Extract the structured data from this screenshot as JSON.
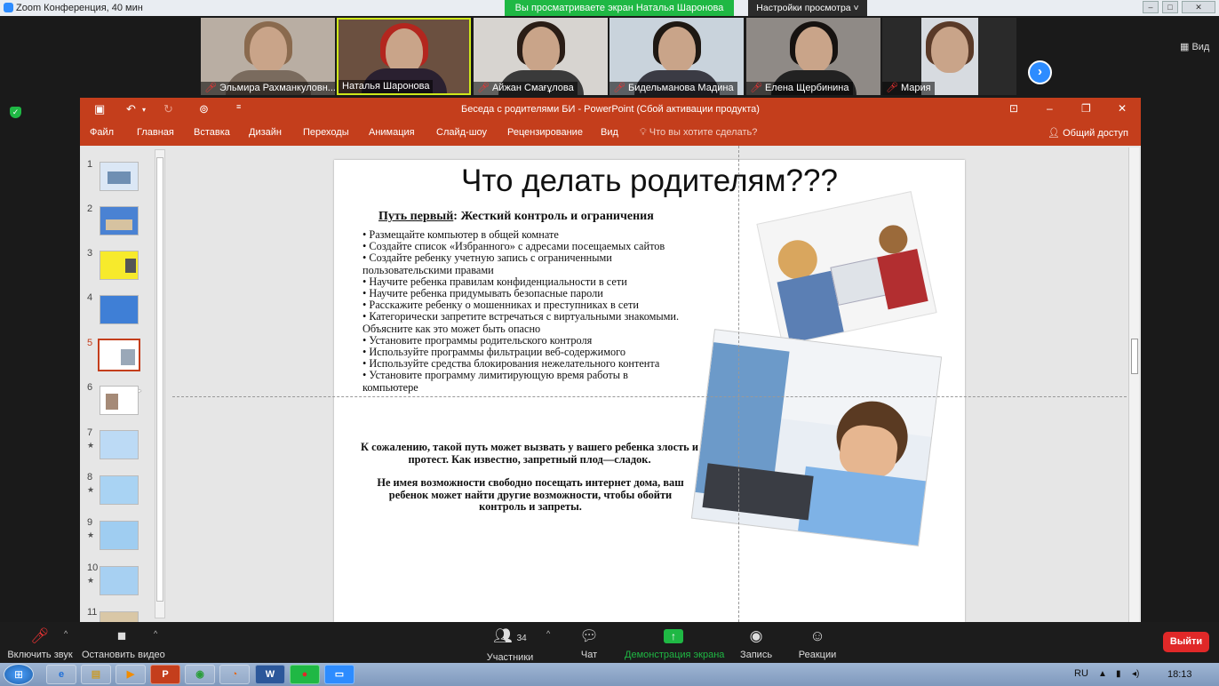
{
  "zoom": {
    "window_title": "Zoom Конференция, 40 мин",
    "share_banner": "Вы просматриваете экран Наталья Шаронова",
    "view_options": "Настройки просмотра ˅",
    "view_button": "▦ Вид",
    "win_minimize": "–",
    "win_maximize": "□",
    "win_close": "✕",
    "next_page_glyph": "›",
    "participants": [
      {
        "name": "Эльмира Рахманкуловн...",
        "muted": true
      },
      {
        "name": "Наталья Шаронова",
        "muted": false
      },
      {
        "name": "Айжан Смағұлова",
        "muted": true
      },
      {
        "name": "Бидельманова Мадина",
        "muted": true
      },
      {
        "name": "Елена Щербинина",
        "muted": true
      },
      {
        "name": "Мария",
        "muted": true
      }
    ],
    "controls": {
      "unmute": "Включить звук",
      "stop_video": "Остановить видео",
      "participants_label": "Участники",
      "participants_count": "34",
      "chat": "Чат",
      "share_screen": "Демонстрация экрана",
      "record": "Запись",
      "reactions": "Реакции",
      "leave": "Выйти"
    },
    "colors": {
      "accent": "#2d8cff",
      "green": "#1fb844",
      "leave": "#e02828"
    }
  },
  "powerpoint": {
    "title": "Беседа с родителями БИ - PowerPoint (Сбой активации продукта)",
    "tabs": [
      "Файл",
      "Главная",
      "Вставка",
      "Дизайн",
      "Переходы",
      "Анимация",
      "Слайд-шоу",
      "Рецензирование",
      "Вид"
    ],
    "tell_me": "Что вы хотите сделать?",
    "share": "Общий доступ",
    "accent_color": "#c43e1c",
    "thumbnails": [
      {
        "num": "1",
        "star": ""
      },
      {
        "num": "2",
        "star": ""
      },
      {
        "num": "3",
        "star": ""
      },
      {
        "num": "4",
        "star": ""
      },
      {
        "num": "5",
        "star": ""
      },
      {
        "num": "6",
        "star": ""
      },
      {
        "num": "7",
        "star": "★"
      },
      {
        "num": "8",
        "star": "★"
      },
      {
        "num": "9",
        "star": "★"
      },
      {
        "num": "10",
        "star": "★"
      },
      {
        "num": "11",
        "star": ""
      }
    ],
    "selected_slide": 5
  },
  "slide": {
    "title": "Что делать родителям???",
    "path_label": "Путь первый",
    "path_rest": ":  Жесткий контроль и ограничения",
    "bullets": [
      "• Размещайте компьютер в общей комнате",
      "• Создайте список «Избранного» с адресами посещаемых сайтов",
      "• Создайте ребенку учетную запись с ограниченными пользовательскими правами",
      "• Научите ребенка правилам конфиденциальности в сети",
      "• Научите ребенка придумывать безопасные пароли",
      "• Расскажите ребенку о мошенниках и преступниках в сети",
      "• Категорически запретите встречаться с виртуальными знакомыми. Объясните как это может быть опасно",
      "• Установите программы родительского контроля",
      "• Используйте программы фильтрации веб-содержимого",
      "• Используйте средства блокирования нежелательного контента",
      "• Установите программу лимитирующую время работы в компьютере"
    ],
    "warning_1": "К сожалению, такой путь может вызвать у вашего ребенка злость и протест. Как известно, запретный плод—сладок.",
    "warning_2": "Не имея возможности свободно посещать интернет дома, ваш ребенок может найти другие возможности, чтобы обойти контроль и запреты."
  },
  "taskbar": {
    "apps": [
      "e",
      "▤",
      "▶",
      "P",
      "◉",
      "◔",
      "W",
      "●",
      "▭"
    ],
    "lang": "RU",
    "time": "18:13",
    "start_glyph": "⊞",
    "tray_up": "▲",
    "tray_net": "▮",
    "tray_vol": "◂)"
  }
}
